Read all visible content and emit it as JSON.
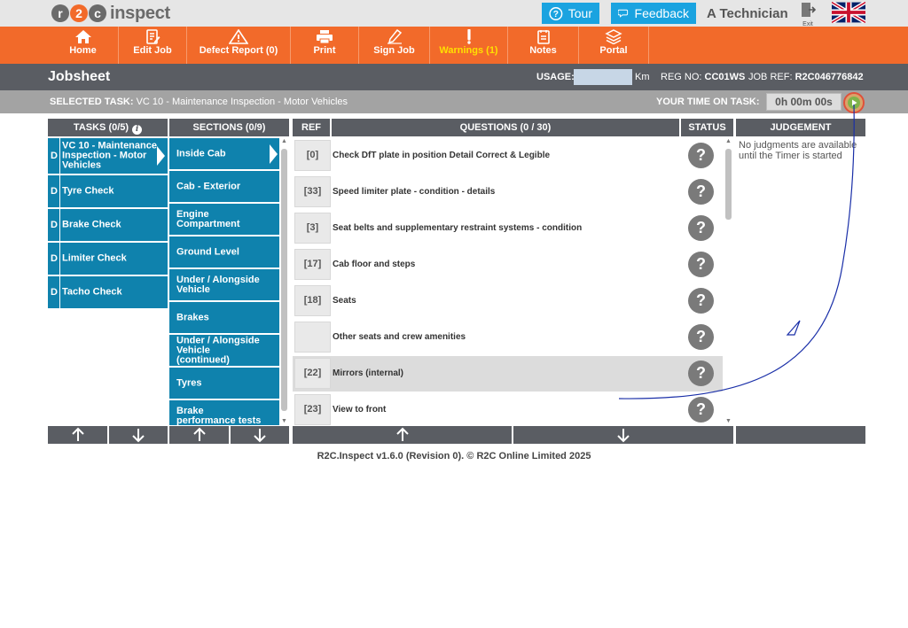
{
  "app": {
    "logo_mark": "r2c",
    "logo_text": "inspect",
    "tour_label": "Tour",
    "feedback_label": "Feedback",
    "user_name": "A Technician",
    "exit_label": "Exit",
    "language_flag": "uk-flag-icon"
  },
  "nav": [
    {
      "label": "Home",
      "icon": "home-icon"
    },
    {
      "label": "Edit Job",
      "icon": "edit-job-icon"
    },
    {
      "label": "Defect Report (0)",
      "icon": "warning-triangle-icon"
    },
    {
      "label": "Print",
      "icon": "printer-icon"
    },
    {
      "label": "Sign Job",
      "icon": "pen-icon"
    },
    {
      "label": "Warnings (1)",
      "icon": "exclamation-icon"
    },
    {
      "label": "Notes",
      "icon": "notes-icon"
    },
    {
      "label": "Portal",
      "icon": "portal-icon"
    }
  ],
  "jobsheet": {
    "title": "Jobsheet",
    "usage_label": "USAGE:",
    "usage_value": "",
    "usage_unit": "Km",
    "reg_label": "REG NO:",
    "reg_value": "CC01WS",
    "jobref_label": "JOB REF:",
    "jobref_value": "R2C046776842"
  },
  "task_bar": {
    "selected_label": "SELECTED TASK:",
    "selected_value": "VC 10 - Maintenance Inspection - Motor Vehicles",
    "time_label": "YOUR TIME ON TASK:",
    "time_value": "0h 00m 00s"
  },
  "columns": {
    "tasks": "TASKS (0/5)",
    "sections": "SECTIONS (0/9)",
    "ref": "REF",
    "questions": "QUESTIONS (0 / 30)",
    "status": "STATUS",
    "judgement": "JUDGEMENT"
  },
  "tasks": [
    {
      "prefix": "D",
      "label": "VC 10 - Maintenance Inspection - Motor Vehicles",
      "selected": true
    },
    {
      "prefix": "D",
      "label": "Tyre Check"
    },
    {
      "prefix": "D",
      "label": "Brake Check"
    },
    {
      "prefix": "D",
      "label": "Limiter Check"
    },
    {
      "prefix": "D",
      "label": "Tacho Check"
    }
  ],
  "sections": [
    {
      "label": "Inside Cab",
      "selected": true
    },
    {
      "label": "Cab - Exterior"
    },
    {
      "label": "Engine Compartment"
    },
    {
      "label": "Ground Level"
    },
    {
      "label": "Under / Alongside Vehicle"
    },
    {
      "label": "Brakes"
    },
    {
      "label": "Under / Alongside Vehicle (continued)"
    },
    {
      "label": "Tyres"
    },
    {
      "label": "Brake performance tests"
    }
  ],
  "questions": [
    {
      "ref": "[0]",
      "text": "Check DfT plate in position Detail Correct & Legible",
      "status": "?"
    },
    {
      "ref": "[33]",
      "text": "Speed limiter plate - condition - details",
      "status": "?"
    },
    {
      "ref": "[3]",
      "text": "Seat belts and supplementary restraint systems - condition",
      "status": "?"
    },
    {
      "ref": "[17]",
      "text": "Cab floor and steps",
      "status": "?"
    },
    {
      "ref": "[18]",
      "text": "Seats",
      "status": "?"
    },
    {
      "ref": "",
      "text": "Other seats and crew amenities",
      "status": "?"
    },
    {
      "ref": "[22]",
      "text": "Mirrors (internal)",
      "status": "?",
      "highlighted": true
    },
    {
      "ref": "[23]",
      "text": "View to front",
      "status": "?"
    }
  ],
  "judgement": {
    "message": "No judgments are available until the Timer is started"
  },
  "footer": {
    "text": "R2C.Inspect v1.6.0 (Revision 0). © R2C Online Limited 2025"
  },
  "colors": {
    "orange": "#f26a2a",
    "blue": "#0f82ad",
    "dark": "#5a5d63",
    "grey": "#a3a3a3",
    "light_blue": "#1aa3e0",
    "warning_yellow": "#ffe000"
  }
}
